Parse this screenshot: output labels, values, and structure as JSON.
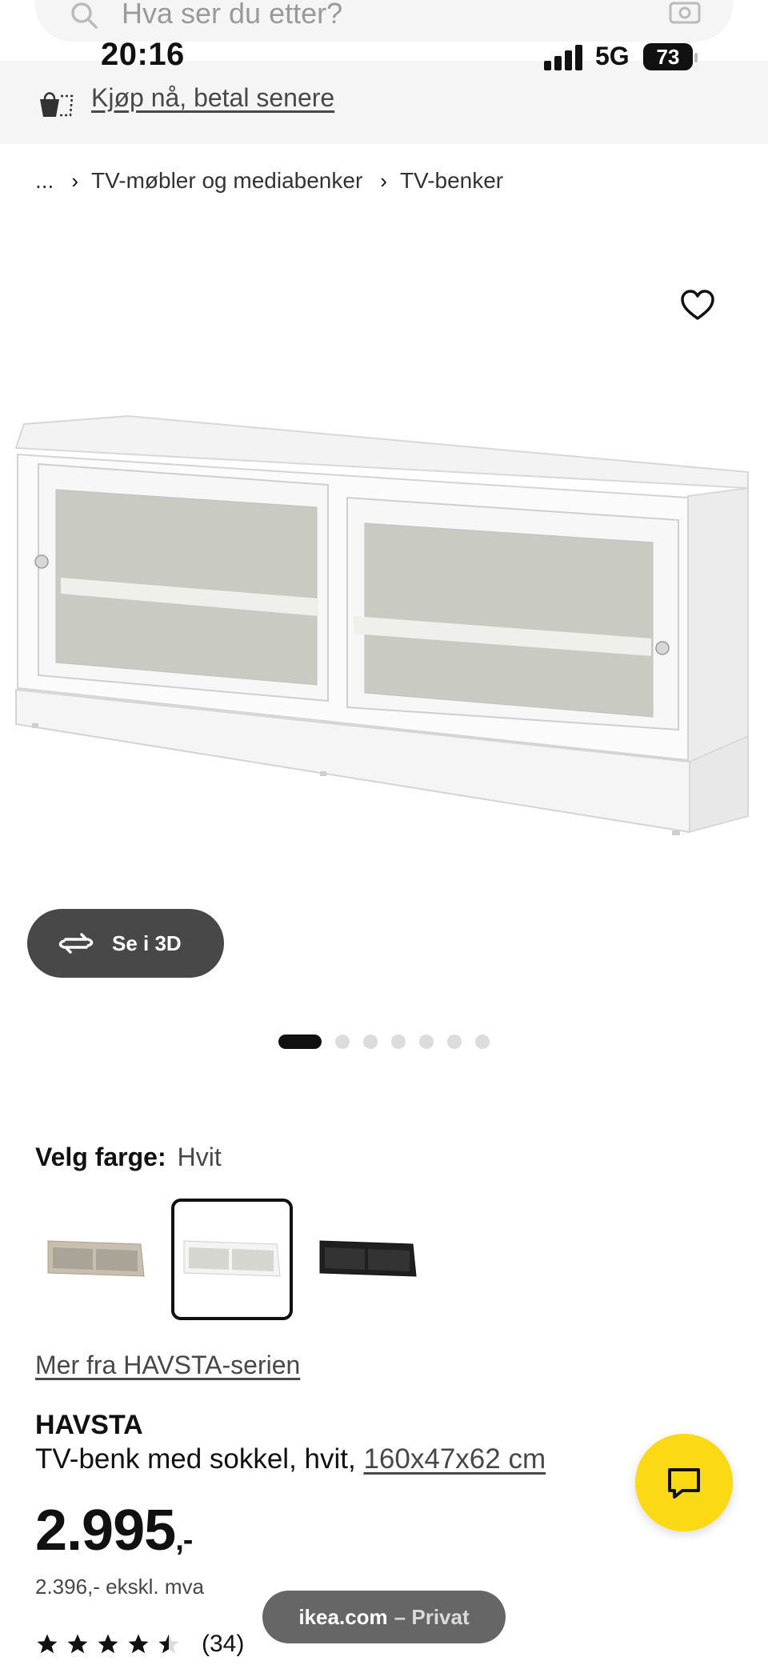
{
  "search": {
    "placeholder": "Hva ser du etter?"
  },
  "status_bar": {
    "time": "20:16",
    "network": "5G",
    "battery": "73"
  },
  "banner": {
    "link": "Kjøp nå, betal senere"
  },
  "breadcrumb": {
    "ellipsis": "...",
    "items": [
      "TV-møbler og mediabenker",
      "TV-benker"
    ]
  },
  "gallery": {
    "view_3d_label": "Se i 3D",
    "image_count": 7,
    "active_index": 0
  },
  "color": {
    "label": "Velg farge:",
    "value": "Hvit",
    "options": [
      "Beige",
      "Hvit",
      "Svart"
    ],
    "selected_index": 1
  },
  "series_link": "Mer fra HAVSTA-serien",
  "product": {
    "name": "HAVSTA",
    "description": "TV-benk med sokkel, hvit,",
    "dimensions": "160x47x62 cm",
    "price": "2.995",
    "price_suffix": ",-",
    "price_ex_vat": "2.396,- ekskl. mva",
    "rating": 4.5,
    "review_count": "(34)"
  },
  "browser_pill": {
    "domain": "ikea.com",
    "mode": "– Privat"
  },
  "colors": {
    "accent_yellow": "#fbd914",
    "dark_button": "#484848",
    "text": "#111111"
  }
}
